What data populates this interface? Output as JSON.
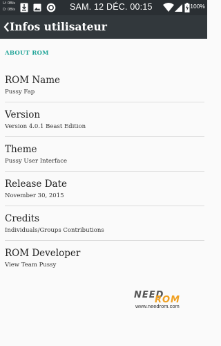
{
  "status_bar": {
    "net_up": "U: 0B/s",
    "net_down": "D: 0B/s",
    "time": "SAM. 12 DÉC. 00:15",
    "battery": "100%"
  },
  "app_bar": {
    "title": "Infos utilisateur"
  },
  "section": {
    "header": "ABOUT ROM"
  },
  "items": [
    {
      "title": "ROM Name",
      "summary": "Pussy Fap"
    },
    {
      "title": "Version",
      "summary": "Version 4.0.1 Beast Edition"
    },
    {
      "title": "Theme",
      "summary": "Pussy User Interface"
    },
    {
      "title": "Release Date",
      "summary": "November 30, 2015"
    },
    {
      "title": "Credits",
      "summary": "Individuals/Groups Contributions"
    },
    {
      "title": "ROM Developer",
      "summary": "View Team Pussy"
    }
  ],
  "watermark": {
    "logo_text": "NEED ROM",
    "url": "www.needrom.com"
  },
  "colors": {
    "accent": "#26a69a",
    "app_bar": "#32383c",
    "status_bar": "#2a2f33"
  }
}
